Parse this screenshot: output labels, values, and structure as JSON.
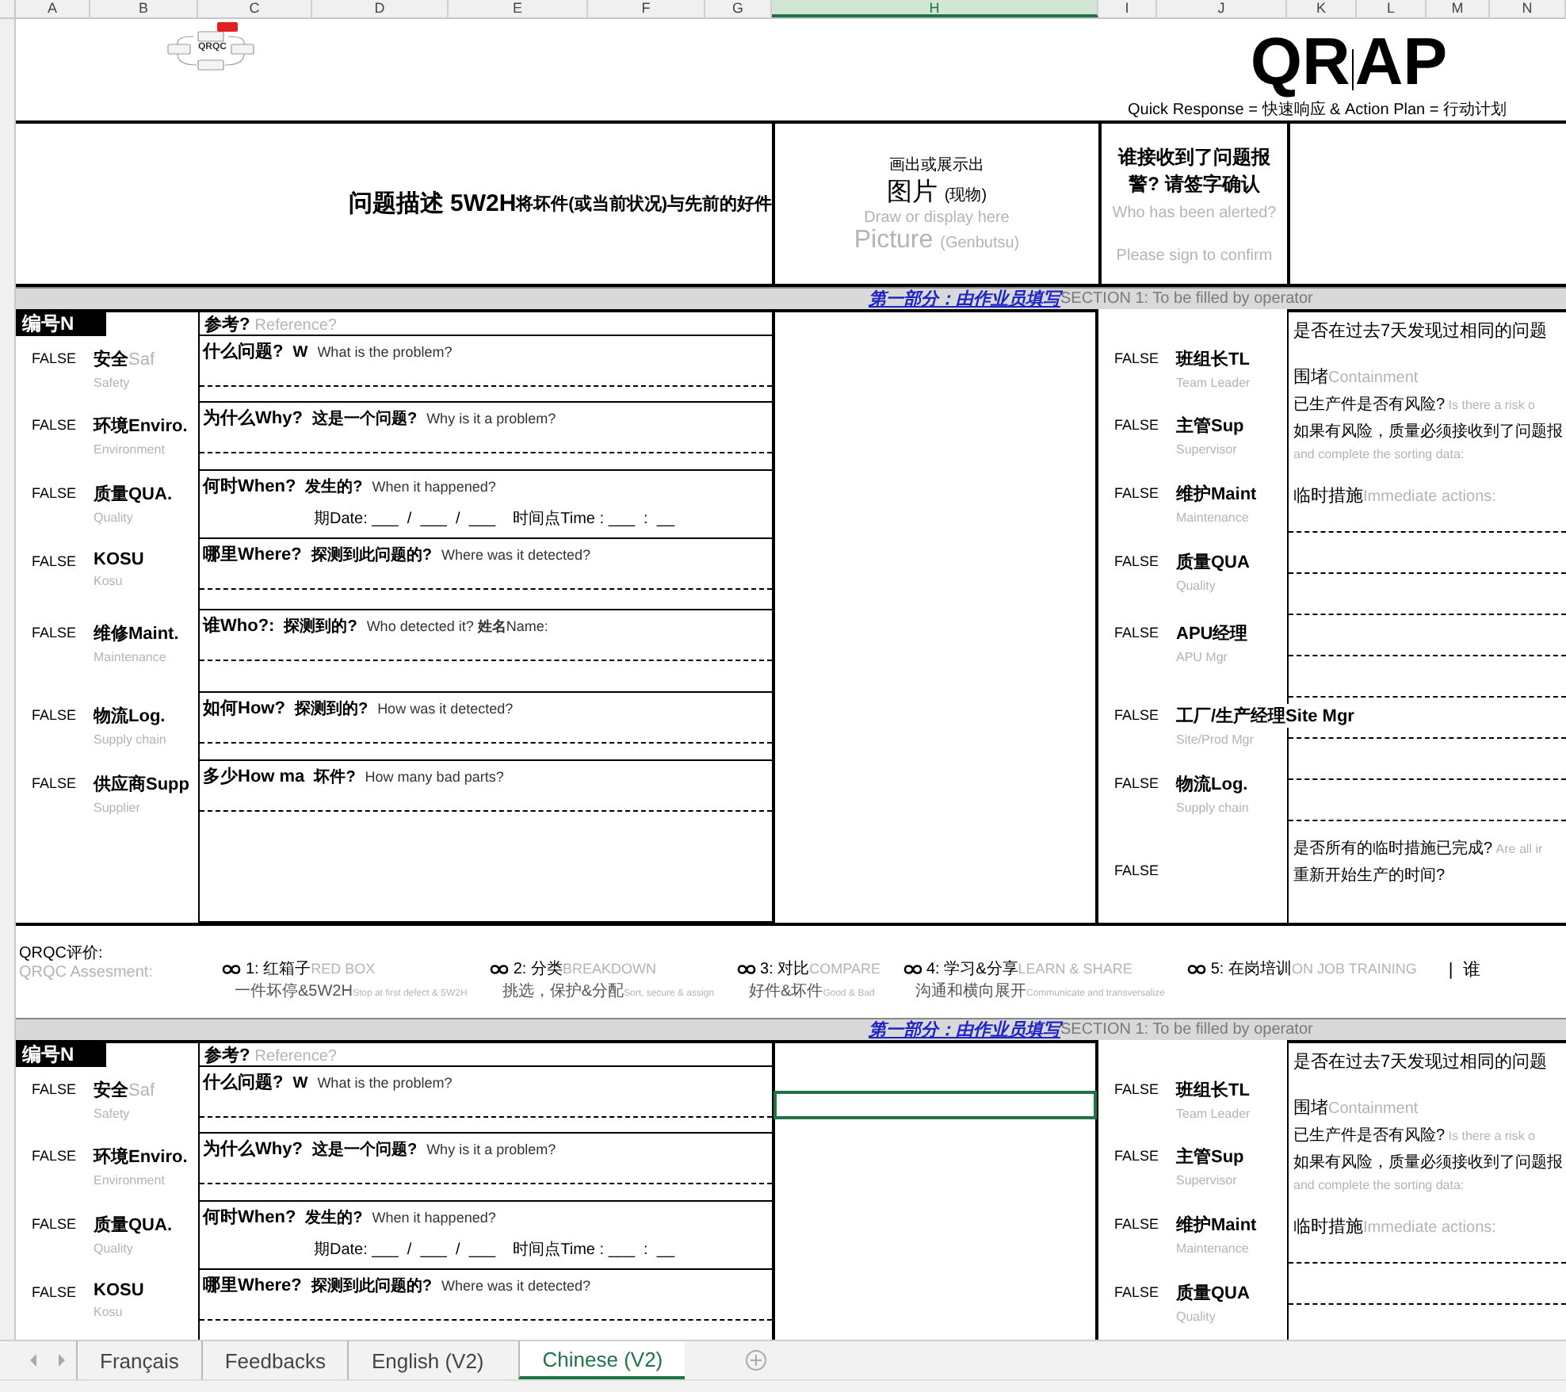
{
  "columns": [
    {
      "label": "A",
      "selected": false
    },
    {
      "label": "B",
      "selected": false
    },
    {
      "label": "C",
      "selected": false
    },
    {
      "label": "D",
      "selected": false
    },
    {
      "label": "E",
      "selected": false
    },
    {
      "label": "F",
      "selected": false
    },
    {
      "label": "G",
      "selected": false
    },
    {
      "label": "H",
      "selected": true
    },
    {
      "label": "I",
      "selected": false
    },
    {
      "label": "J",
      "selected": false
    },
    {
      "label": "K",
      "selected": false
    },
    {
      "label": "L",
      "selected": false
    },
    {
      "label": "M",
      "selected": false
    },
    {
      "label": "N",
      "selected": false
    }
  ],
  "logo": {
    "text": "QRQC"
  },
  "title": {
    "left": "QR",
    "right": "AP",
    "subtitle": "Quick Response = 快速响应 & Action Plan = 行动计划"
  },
  "header": {
    "problem_title": "问题描述 5W2H",
    "problem_detail": "将坏件(或当前状况)与先前的好件",
    "picture": {
      "line1": "画出或展示出",
      "title": "图片",
      "title_note": "(现物)",
      "hint": "Draw or display here",
      "title_en": "Picture",
      "title_en_note": "(Genbutsu)"
    },
    "alert": {
      "title": "谁接收到了问题报警? 请签字确认",
      "hint": "Who has been alerted?",
      "sign": "Please sign to confirm"
    }
  },
  "sections": [
    {
      "banner": {
        "title": "第一部分：由作业员填写",
        "subtitle": "SECTION 1: To be filled by operator"
      },
      "id_label": "编号N",
      "reference": {
        "label": "参考?",
        "hint": "Reference?"
      },
      "picture_cell_selected": false,
      "departments": [
        {
          "value": "FALSE",
          "label": "安全",
          "label_note": "Saf",
          "sub": "Safety"
        },
        {
          "value": "FALSE",
          "label": "环境Enviro.",
          "sub": "Environment"
        },
        {
          "value": "FALSE",
          "label": "质量QUA.",
          "sub": "Quality"
        },
        {
          "value": "FALSE",
          "label": "KOSU",
          "sub": "Kosu"
        },
        {
          "value": "FALSE",
          "label": "维修Maint.",
          "sub": "Maintenance"
        },
        {
          "value": "FALSE",
          "label": "物流Log.",
          "sub": "Supply chain"
        },
        {
          "value": "FALSE",
          "label": "供应商Supp",
          "sub": "Supplier"
        }
      ],
      "questions": [
        {
          "kind": "line",
          "label": "什么问题?",
          "prompt": "W",
          "english": "What is the problem?"
        },
        {
          "kind": "line",
          "label": "为什么Why?",
          "prompt": "这是一个问题?",
          "english": "Why is it a problem?"
        },
        {
          "kind": "date",
          "label": "何时When?",
          "prompt": "发生的?",
          "english": "When it happened?",
          "extra": "期Date: ___  /  ___  /  ___    时间点Time : ___  :  __"
        },
        {
          "kind": "line",
          "label": "哪里Where?",
          "prompt": "探测到此问题的?",
          "english": "Where was it detected?"
        },
        {
          "kind": "line",
          "label": "谁Who?:",
          "prompt": "探测到的?",
          "english": "Who detected it? **姓名**Name:"
        },
        {
          "kind": "line",
          "label": "如何How?",
          "prompt": "探测到的?",
          "english": "How was it detected?"
        },
        {
          "kind": "line",
          "label": "多少How ma",
          "prompt": "坏件?",
          "english": "How many bad parts?"
        }
      ],
      "alerts": [
        {
          "value": "FALSE",
          "label": "班组长TL",
          "sub": "Team Leader"
        },
        {
          "value": "FALSE",
          "label": "主管Sup",
          "sub": "Supervisor"
        },
        {
          "value": "FALSE",
          "label": "维护Maint",
          "sub": "Maintenance"
        },
        {
          "value": "FALSE",
          "label": "质量QUA",
          "sub": "Quality"
        },
        {
          "value": "FALSE",
          "label": "APU经理",
          "sub": "APU Mgr"
        },
        {
          "value": "FALSE",
          "label": "工厂/生产经理Site Mgr",
          "sub": "Site/Prod Mgr"
        },
        {
          "value": "FALSE",
          "label": "物流Log.",
          "sub": "Supply chain"
        },
        {
          "value": "FALSE"
        }
      ],
      "notes": [
        {
          "kind": "heading",
          "text": "是否在过去7天发现过相同的问题"
        },
        {
          "kind": "heading",
          "text": "围堵",
          "note": "Containment"
        },
        {
          "kind": "text",
          "text": "已生产件是否有风险?",
          "note": "Is there a risk o"
        },
        {
          "kind": "text",
          "text": "如果有风险，质量必须接收到了问题报"
        },
        {
          "kind": "hint",
          "text": "and complete the sorting data:"
        },
        {
          "kind": "heading",
          "text": "临时措施",
          "note": "Immediate actions:"
        },
        {
          "kind": "rule"
        },
        {
          "kind": "rule"
        },
        {
          "kind": "rule"
        },
        {
          "kind": "rule"
        },
        {
          "kind": "rule"
        },
        {
          "kind": "rule"
        },
        {
          "kind": "rule"
        },
        {
          "kind": "rule"
        },
        {
          "kind": "text",
          "text": "是否所有的临时措施已完成?",
          "note": "Are all ir"
        },
        {
          "kind": "text",
          "text": "重新开始生产的时间?"
        }
      ]
    },
    {
      "banner": {
        "title": "第一部分：由作业员填写",
        "subtitle": "SECTION 1: To be filled by operator"
      },
      "id_label": "编号N",
      "reference": {
        "label": "参考?",
        "hint": "Reference?"
      },
      "picture_cell_selected": true,
      "departments": [
        {
          "value": "FALSE",
          "label": "安全",
          "label_note": "Saf",
          "sub": "Safety"
        },
        {
          "value": "FALSE",
          "label": "环境Enviro.",
          "sub": "Environment"
        },
        {
          "value": "FALSE",
          "label": "质量QUA.",
          "sub": "Quality"
        },
        {
          "value": "FALSE",
          "label": "KOSU",
          "sub": "Kosu"
        }
      ],
      "questions": [
        {
          "kind": "line",
          "label": "什么问题?",
          "prompt": "W",
          "english": "What is the problem?"
        },
        {
          "kind": "line",
          "label": "为什么Why?",
          "prompt": "这是一个问题?",
          "english": "Why is it a problem?"
        },
        {
          "kind": "date",
          "label": "何时When?",
          "prompt": "发生的?",
          "english": "When it happened?",
          "extra": "期Date: ___  /  ___  /  ___    时间点Time : ___  :  __"
        },
        {
          "kind": "line",
          "label": "哪里Where?",
          "prompt": "探测到此问题的?",
          "english": "Where was it detected?"
        }
      ],
      "alerts": [
        {
          "value": "FALSE",
          "label": "班组长TL",
          "sub": "Team Leader"
        },
        {
          "value": "FALSE",
          "label": "主管Sup",
          "sub": "Supervisor"
        },
        {
          "value": "FALSE",
          "label": "维护Maint",
          "sub": "Maintenance"
        },
        {
          "value": "FALSE",
          "label": "质量QUA",
          "sub": "Quality"
        }
      ],
      "notes": [
        {
          "kind": "heading",
          "text": "是否在过去7天发现过相同的问题"
        },
        {
          "kind": "heading",
          "text": "围堵",
          "note": "Containment"
        },
        {
          "kind": "text",
          "text": "已生产件是否有风险?",
          "note": "Is there a risk o"
        },
        {
          "kind": "text",
          "text": "如果有风险，质量必须接收到了问题报"
        },
        {
          "kind": "hint",
          "text": "and complete the sorting data:"
        },
        {
          "kind": "heading",
          "text": "临时措施",
          "note": "Immediate actions:"
        },
        {
          "kind": "rule"
        },
        {
          "kind": "rule"
        }
      ]
    }
  ],
  "assessment": {
    "title": "QRQC评价:",
    "subtitle": "QRQC Assesment:",
    "steps": [
      {
        "label": "1: 红箱子",
        "label_en": "RED BOX",
        "note": "一件坏停&5W2H",
        "note_en": "Stop at first defect & 5W2H"
      },
      {
        "label": "2: 分类",
        "label_en": "BREAKDOWN",
        "note": "挑选，保护&分配",
        "note_en": "Sort, secure & assign"
      },
      {
        "label": "3: 对比",
        "label_en": "COMPARE",
        "note": "好件&坏件",
        "note_en": "Good & Bad"
      },
      {
        "label": "4: 学习&分享",
        "label_en": "LEARN & SHARE",
        "note": "沟通和横向展开",
        "note_en": "Communicate and transversalize"
      },
      {
        "label": "5: 在岗培训",
        "label_en": "ON JOB TRAINING"
      }
    ],
    "trailing": "|  谁"
  },
  "sheet_tabs": [
    {
      "label": "Français",
      "selected": false
    },
    {
      "label": "Feedbacks",
      "selected": false
    },
    {
      "label": "English (V2)",
      "selected": false
    },
    {
      "label": "Chinese (V2)",
      "selected": true
    }
  ]
}
